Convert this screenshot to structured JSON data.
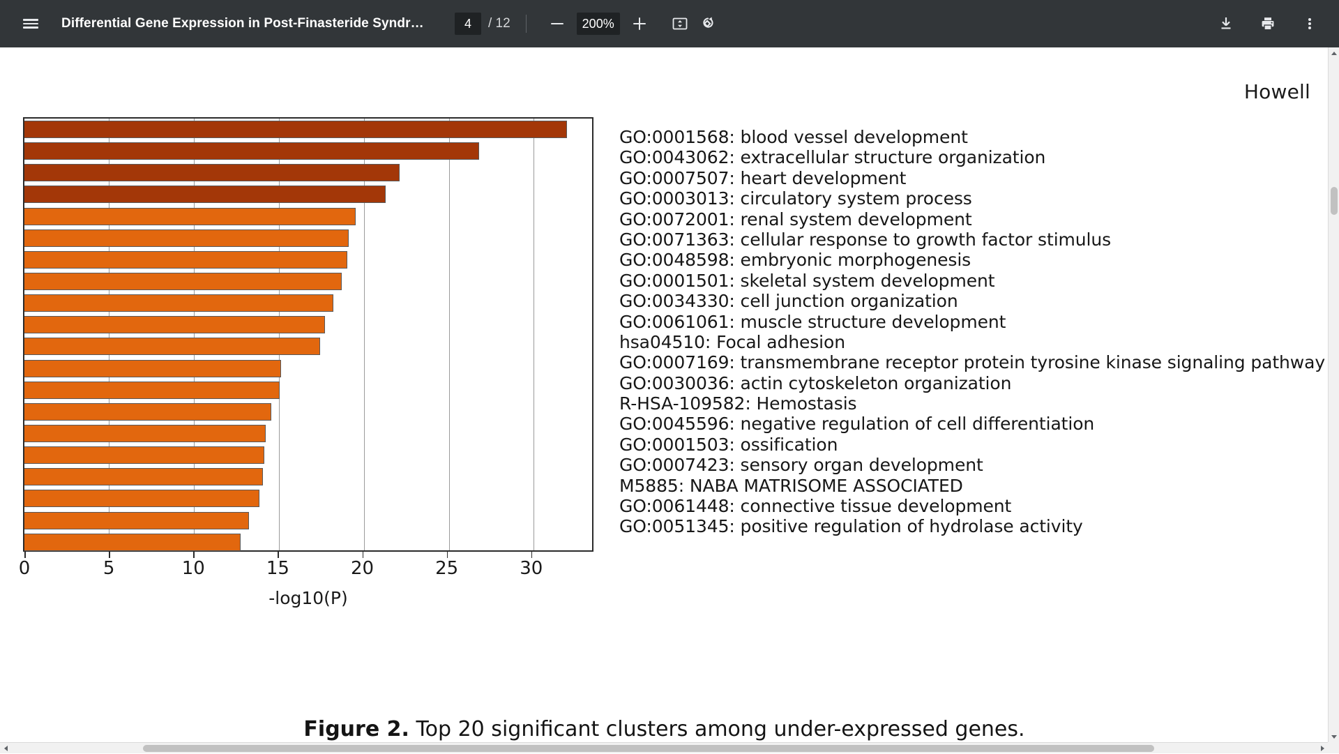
{
  "toolbar": {
    "menu_icon": "hamburger-menu-icon",
    "document_title": "Differential Gene Expression in Post-Finasteride Syndrome Pati…",
    "current_page": "4",
    "page_total": "/ 12",
    "zoom_out_icon": "minus-icon",
    "zoom_level": "200%",
    "zoom_in_icon": "plus-icon",
    "fit_page_icon": "fit-to-page-icon",
    "rotate_icon": "rotate-counterclockwise-icon",
    "download_icon": "download-icon",
    "print_icon": "print-icon",
    "more_icon": "more-vertical-icon"
  },
  "document": {
    "running_head": "Howell",
    "caption_prefix": "Figure 2.",
    "caption_text": "Top 20 significant clusters among under-expressed genes."
  },
  "chart_data": {
    "type": "bar",
    "orientation": "horizontal",
    "title": "",
    "xlabel": "-log10(P)",
    "ylabel": "",
    "xlim": [
      0,
      33.6
    ],
    "xticks": [
      0,
      5,
      10,
      15,
      20,
      25,
      30
    ],
    "xtick_labels": [
      "0",
      "5",
      "10",
      "15",
      "20",
      "25",
      "30"
    ],
    "grid": true,
    "legend": "none",
    "colors": {
      "dark_bar": "#A33708",
      "light_bar": "#E2670E",
      "bar_border": "#58595b",
      "axis": "#2a2a2a",
      "gridline": "#9a9a9a"
    },
    "categories": [
      "GO:0001568: blood vessel development",
      "GO:0043062: extracellular structure organization",
      "GO:0007507: heart development",
      "GO:0003013: circulatory system process",
      "GO:0072001: renal system development",
      "GO:0071363: cellular response to growth factor stimulus",
      "GO:0048598: embryonic morphogenesis",
      "GO:0001501: skeletal system development",
      "GO:0034330: cell junction organization",
      "GO:0061061: muscle structure development",
      "hsa04510: Focal adhesion",
      "GO:0007169: transmembrane receptor protein tyrosine kinase signaling pathway",
      "GO:0030036: actin cytoskeleton organization",
      "R-HSA-109582: Hemostasis",
      "GO:0045596: negative regulation of cell differentiation",
      "GO:0001503: ossification",
      "GO:0007423: sensory organ development",
      "M5885: NABA MATRISOME ASSOCIATED",
      "GO:0061448: connective tissue development",
      "GO:0051345: positive regulation of hydrolase activity"
    ],
    "values": [
      32.1,
      26.9,
      22.2,
      21.4,
      19.6,
      19.2,
      19.1,
      18.8,
      18.3,
      17.8,
      17.5,
      15.2,
      15.1,
      14.6,
      14.3,
      14.2,
      14.1,
      13.9,
      13.3,
      12.8
    ],
    "bar_colors": [
      "#A33708",
      "#A33708",
      "#A33708",
      "#A33708",
      "#E2670E",
      "#E2670E",
      "#E2670E",
      "#E2670E",
      "#E2670E",
      "#E2670E",
      "#E2670E",
      "#E2670E",
      "#E2670E",
      "#E2670E",
      "#E2670E",
      "#E2670E",
      "#E2670E",
      "#E2670E",
      "#E2670E",
      "#E2670E"
    ]
  }
}
